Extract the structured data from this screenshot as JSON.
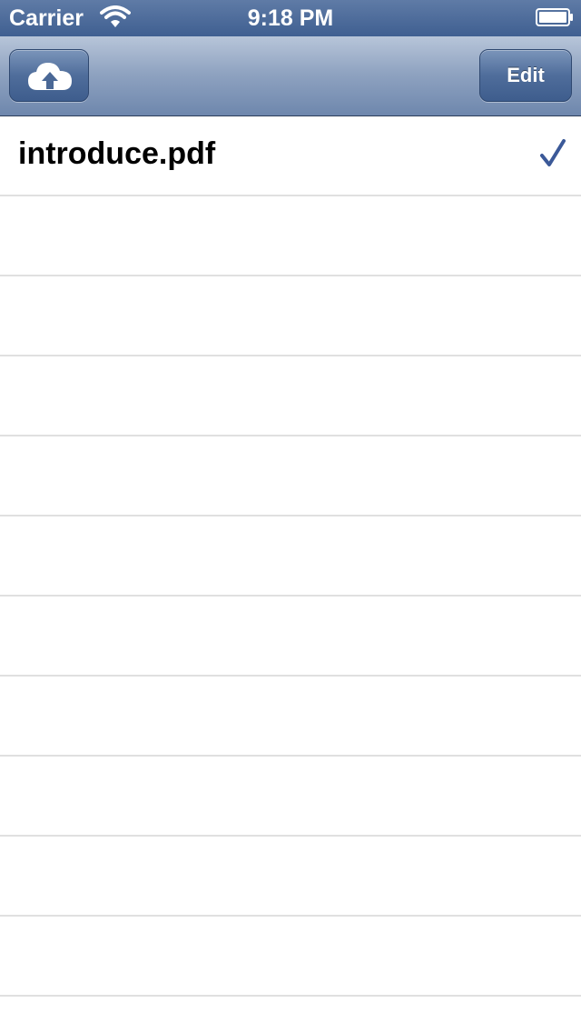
{
  "status_bar": {
    "carrier": "Carrier",
    "time": "9:18 PM",
    "wifi_icon": "wifi-icon",
    "battery_icon": "battery-icon"
  },
  "nav_bar": {
    "upload_icon": "cloud-upload-icon",
    "edit_label": "Edit"
  },
  "files": [
    {
      "name": "introduce.pdf",
      "selected": true
    }
  ],
  "colors": {
    "nav_tint": "#4f6d9b",
    "checkmark": "#3b5998",
    "separator": "#e0e0e0"
  }
}
